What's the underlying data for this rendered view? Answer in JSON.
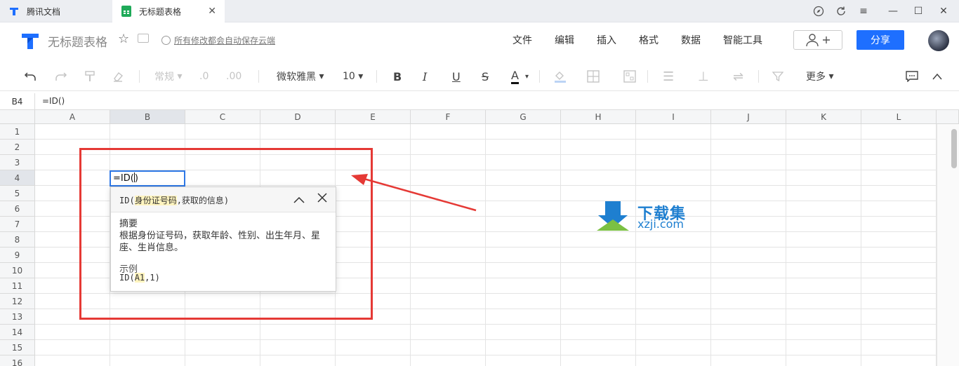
{
  "tabs": [
    {
      "label": "腾讯文档"
    },
    {
      "label": "无标题表格"
    }
  ],
  "header": {
    "title": "无标题表格",
    "saved_status": "所有修改都会自动保存云端",
    "menus": [
      "文件",
      "编辑",
      "插入",
      "格式",
      "数据",
      "智能工具"
    ],
    "share_label": "分享"
  },
  "toolbar": {
    "number_format": "常规",
    "font_name": "微软雅黑",
    "font_size": "10",
    "more_label": "更多"
  },
  "formula_bar": {
    "cell_ref": "B4",
    "formula": "=ID()"
  },
  "grid": {
    "columns": [
      "A",
      "B",
      "C",
      "D",
      "E",
      "F",
      "G",
      "H",
      "I",
      "J",
      "K",
      "L"
    ],
    "rows": [
      "1",
      "2",
      "3",
      "4",
      "5",
      "6",
      "7",
      "8",
      "9",
      "10",
      "11",
      "12",
      "13",
      "14",
      "15",
      "16"
    ],
    "selected_column": "B",
    "selected_row": "4",
    "active_cell_value": "=ID("
  },
  "formula_tip": {
    "fn_name": "ID(",
    "param1": "身份证号码",
    "param2": ",获取的信息)",
    "summary_title": "摘要",
    "summary_text": "根据身份证号码，获取年龄、性别、出生年月、星座、生肖信息。",
    "example_title": "示例",
    "example_pre": "ID(",
    "example_arg": "A1",
    "example_post": ",1)"
  },
  "watermark": {
    "name": "下载集",
    "url": "xzji.com"
  },
  "colors": {
    "accent": "#1e6fff",
    "highlight_box": "#e53935",
    "active_cell_border": "#2e78e6"
  }
}
